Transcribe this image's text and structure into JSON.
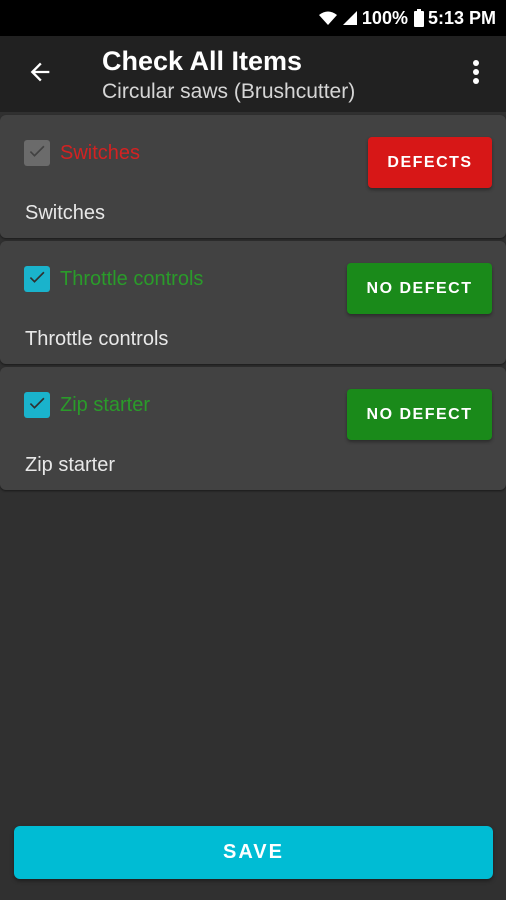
{
  "status_bar": {
    "battery": "100%",
    "time": "5:13 PM",
    "icons": [
      "wifi-icon",
      "signal-icon",
      "battery-icon"
    ]
  },
  "header": {
    "title": "Check All Items",
    "subtitle": "Circular saws (Brushcutter)",
    "back_icon": "arrow-left-icon",
    "menu_icon": "more-vert-icon"
  },
  "items": [
    {
      "title": "Switches",
      "description": "Switches",
      "checked": true,
      "enabled": false,
      "status_label": "DEFECTS",
      "status": "defect"
    },
    {
      "title": "Throttle controls",
      "description": "Throttle controls",
      "checked": true,
      "enabled": true,
      "status_label": "NO DEFECT",
      "status": "no-defect"
    },
    {
      "title": "Zip starter",
      "description": "Zip starter",
      "checked": true,
      "enabled": true,
      "status_label": "NO DEFECT",
      "status": "no-defect"
    }
  ],
  "footer": {
    "save_label": "SAVE"
  },
  "colors": {
    "background": "#303030",
    "app_bar": "#212121",
    "card": "#424242",
    "defect": "#d71717",
    "no_defect": "#1a8a1a",
    "accent": "#00bcd4"
  }
}
